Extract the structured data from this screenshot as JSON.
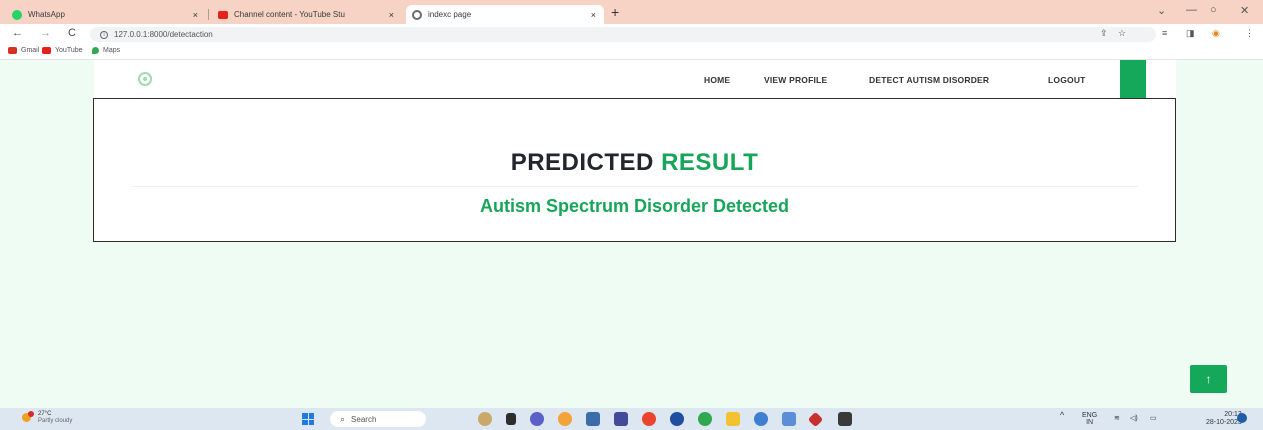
{
  "browser": {
    "tabs": [
      {
        "title": "WhatsApp",
        "close": "×",
        "favicon_color": "#25d366",
        "active": false
      },
      {
        "title": "Channel content - YouTube Stu",
        "close": "×",
        "favicon_color": "#e62117",
        "active": false
      },
      {
        "title": "indexc page",
        "close": "×",
        "favicon_color": "#6b6b6b",
        "active": true
      }
    ],
    "new_tab": "+",
    "window_controls": {
      "chevron": "⌄",
      "minimize": "—",
      "restore": "○",
      "close": "✕"
    },
    "nav": {
      "back": "←",
      "forward": "→",
      "reload": "C"
    },
    "url": "127.0.0.1:8000/detectaction",
    "bookmarks": [
      {
        "label": "Gmail",
        "color": "#d93025"
      },
      {
        "label": "YouTube",
        "color": "#e62117"
      },
      {
        "label": "Maps",
        "color": "#34a853"
      }
    ]
  },
  "site": {
    "nav": {
      "home": "HOME",
      "view_profile": "VIEW PROFILE",
      "detect": "DETECT AUTISM DISORDER",
      "logout": "LOGOUT"
    },
    "heading_prefix": "PREDICTED",
    "heading_accent": "RESULT",
    "result": "Autism Spectrum Disorder Detected",
    "back_to_top": "↑",
    "accent_color": "#17a55a"
  },
  "taskbar": {
    "weather_temp": "27°C",
    "weather_desc": "Partly cloudy",
    "search_placeholder": "Search",
    "lang_top": "ENG",
    "lang_bottom": "IN",
    "time": "20:13",
    "date": "28-10-2023"
  }
}
